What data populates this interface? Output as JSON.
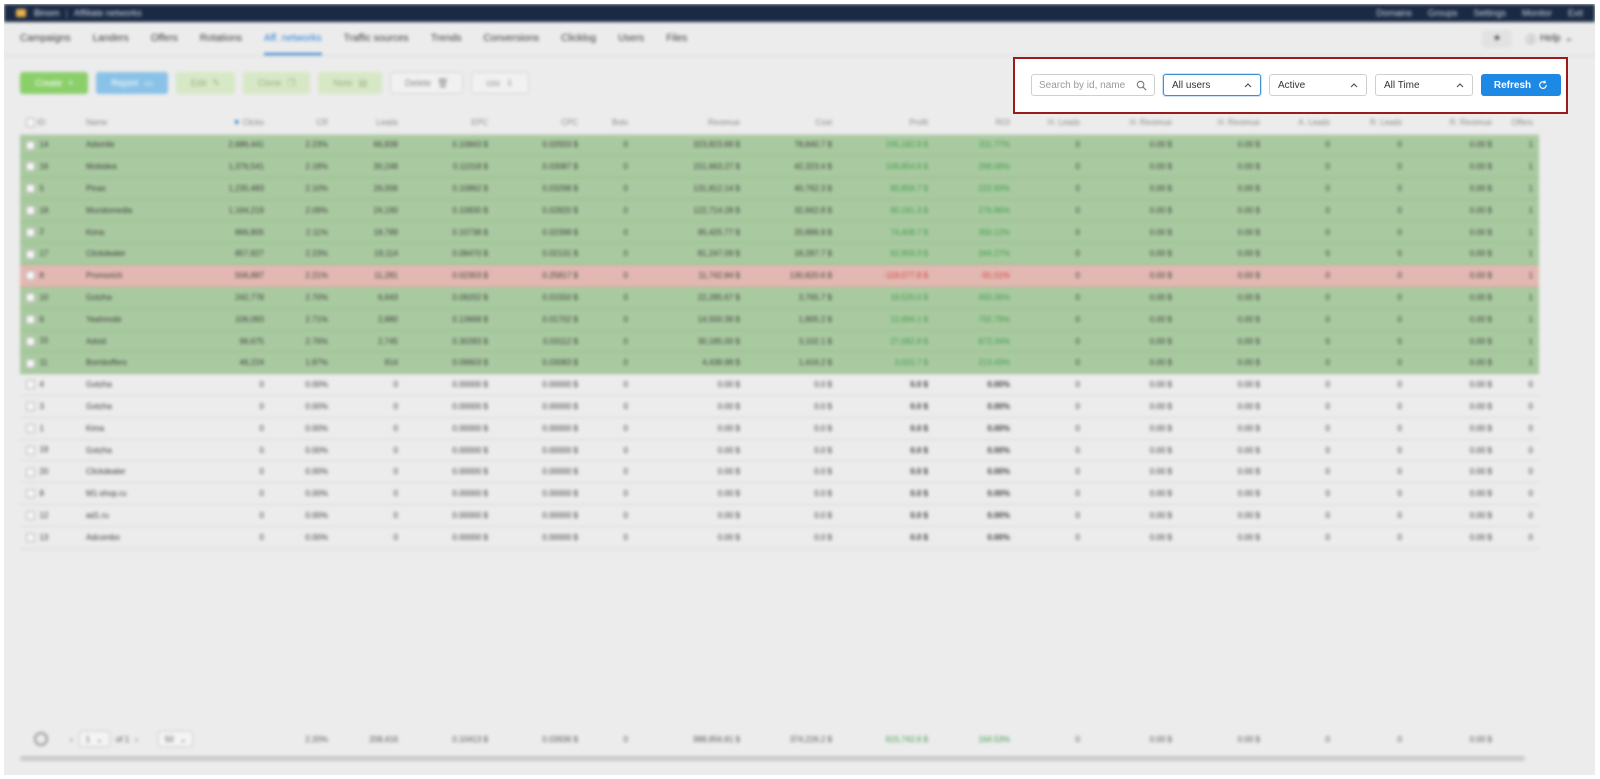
{
  "app": {
    "brand": "Binom",
    "section": "Affiliate networks",
    "top_links": [
      "Domains",
      "Groups",
      "Settings",
      "Monitor",
      "Exit"
    ]
  },
  "nav": {
    "tabs": [
      "Campaigns",
      "Landers",
      "Offers",
      "Rotations",
      "Aff. networks",
      "Traffic sources",
      "Trends",
      "Conversions",
      "Clicklog",
      "Users",
      "Files"
    ],
    "active_tab": "Aff. networks",
    "help_label": "Help"
  },
  "toolbar": {
    "create": "Create",
    "report": "Report",
    "edit": "Edit",
    "clone": "Clone",
    "note": "Note",
    "delete": "Delete",
    "csv": "csv"
  },
  "filters": {
    "search_placeholder": "Search by id, name",
    "users": "All users",
    "status": "Active",
    "period": "All Time",
    "refresh": "Refresh"
  },
  "table": {
    "columns": [
      "ID",
      "Name",
      "Clicks",
      "CR",
      "Leads",
      "EPC",
      "CPC",
      "Bots",
      "Revenue",
      "Cost",
      "Profit",
      "ROI",
      "H. Leads",
      "H. Revenue",
      "H. Revenue",
      "A. Leads",
      "R. Leads",
      "R. Revenue",
      "Offers"
    ],
    "rows": [
      {
        "status": "green",
        "id": "14",
        "name": "Adsmile",
        "clicks": "2,686,441",
        "cr": "2.23%",
        "leads": "66,839",
        "epc": "0.10843 $",
        "cpc": "0.02933 $",
        "bots": "0",
        "revenue": "323,823.89 $",
        "cost": "78,840.7 $",
        "profit": "245,182.9 $",
        "roi": "311.77%",
        "h1": "0",
        "h2": "0.00 $",
        "h3": "0.00 $",
        "h4": "0",
        "h5": "0",
        "h6": "0.00 $",
        "offers": "1"
      },
      {
        "status": "green",
        "id": "16",
        "name": "Mobidea",
        "clicks": "1,376,541",
        "cr": "2.18%",
        "leads": "30,248",
        "epc": "0.11018 $",
        "cpc": "0.03087 $",
        "bots": "0",
        "revenue": "151,663.27 $",
        "cost": "42,323.4 $",
        "profit": "109,854.9 $",
        "roi": "268.08%",
        "h1": "0",
        "h2": "0.00 $",
        "h3": "0.00 $",
        "h4": "0",
        "h5": "0",
        "h6": "0.00 $",
        "offers": "1"
      },
      {
        "status": "green",
        "id": "5",
        "name": "Pinax",
        "clicks": "1,235,483",
        "cr": "2.10%",
        "leads": "26,006",
        "epc": "0.10862 $",
        "cpc": "0.03298 $",
        "bots": "0",
        "revenue": "131,812.14 $",
        "cost": "40,762.3 $",
        "profit": "90,858.7 $",
        "roi": "222.93%",
        "h1": "0",
        "h2": "0.00 $",
        "h3": "0.00 $",
        "h4": "0",
        "h5": "0",
        "h6": "0.00 $",
        "offers": "1"
      },
      {
        "status": "green",
        "id": "18",
        "name": "Mundomedia",
        "clicks": "1,164,219",
        "cr": "2.09%",
        "leads": "24,190",
        "epc": "0.10830 $",
        "cpc": "0.02820 $",
        "bots": "0",
        "revenue": "122,714.28 $",
        "cost": "32,662.8 $",
        "profit": "90,181.3 $",
        "roi": "276.96%",
        "h1": "0",
        "h2": "0.00 $",
        "h3": "0.00 $",
        "h4": "0",
        "h5": "0",
        "h6": "0.00 $",
        "offers": "1"
      },
      {
        "status": "green",
        "id": "2",
        "name": "Kima",
        "clicks": "866,805",
        "cr": "2.11%",
        "leads": "18,789",
        "epc": "0.10738 $",
        "cpc": "0.02398 $",
        "bots": "0",
        "revenue": "95,425.77 $",
        "cost": "20,886.9 $",
        "profit": "74,408.7 $",
        "roi": "350.12%",
        "h1": "0",
        "h2": "0.00 $",
        "h3": "0.00 $",
        "h4": "0",
        "h5": "0",
        "h6": "0.00 $",
        "offers": "1"
      },
      {
        "status": "green",
        "id": "17",
        "name": "Clickdealer",
        "clicks": "857,827",
        "cr": "2.23%",
        "leads": "19,114",
        "epc": "0.08470 $",
        "cpc": "0.02131 $",
        "bots": "0",
        "revenue": "81,247.09 $",
        "cost": "18,287.7 $",
        "profit": "62,959.3 $",
        "roi": "344.27%",
        "h1": "0",
        "h2": "0.00 $",
        "h3": "0.00 $",
        "h4": "0",
        "h5": "0",
        "h6": "0.00 $",
        "offers": "1"
      },
      {
        "status": "red",
        "id": "8",
        "name": "Promorich",
        "clicks": "506,887",
        "cr": "2.21%",
        "leads": "11,281",
        "epc": "0.02303 $",
        "cpc": "0.25817 $",
        "bots": "0",
        "revenue": "11,742.84 $",
        "cost": "130,820.6 $",
        "profit": "-119,077.8 $",
        "roi": "-91.01%",
        "h1": "0",
        "h2": "0.00 $",
        "h3": "0.00 $",
        "h4": "0",
        "h5": "0",
        "h6": "0.00 $",
        "offers": "1"
      },
      {
        "status": "green",
        "id": "10",
        "name": "Gotzha",
        "clicks": "242,778",
        "cr": "2.70%",
        "leads": "6,643",
        "epc": "0.09202 $",
        "cpc": "0.01550 $",
        "bots": "0",
        "revenue": "22,285.67 $",
        "cost": "3,765.7 $",
        "profit": "18,520.0 $",
        "roi": "493.36%",
        "h1": "0",
        "h2": "0.00 $",
        "h3": "0.00 $",
        "h4": "0",
        "h5": "0",
        "h6": "0.00 $",
        "offers": "1"
      },
      {
        "status": "green",
        "id": "6",
        "name": "Yeahmobi",
        "clicks": "106,083",
        "cr": "2.71%",
        "leads": "2,880",
        "epc": "0.13668 $",
        "cpc": "0.01702 $",
        "bots": "0",
        "revenue": "14,500.39 $",
        "cost": "1,805.2 $",
        "profit": "12,694.1 $",
        "roi": "702.79%",
        "h1": "0",
        "h2": "0.00 $",
        "h3": "0.00 $",
        "h4": "0",
        "h5": "0",
        "h6": "0.00 $",
        "offers": "1"
      },
      {
        "status": "green",
        "id": "15",
        "name": "Advid",
        "clicks": "96,675",
        "cr": "2.76%",
        "leads": "2,745",
        "epc": "0.30283 $",
        "cpc": "0.03112 $",
        "bots": "0",
        "revenue": "30,185.00 $",
        "cost": "3,102.1 $",
        "profit": "27,082.8 $",
        "roi": "873.34%",
        "h1": "0",
        "h2": "0.00 $",
        "h3": "0.00 $",
        "h4": "0",
        "h5": "0",
        "h6": "0.00 $",
        "offers": "1"
      },
      {
        "status": "green",
        "id": "11",
        "name": "Bomboffers",
        "clicks": "46,224",
        "cr": "1.87%",
        "leads": "814",
        "epc": "0.09603 $",
        "cpc": "0.03083 $",
        "bots": "0",
        "revenue": "4,438.98 $",
        "cost": "1,416.2 $",
        "profit": "3,022.7 $",
        "roi": "213.43%",
        "h1": "0",
        "h2": "0.00 $",
        "h3": "0.00 $",
        "h4": "0",
        "h5": "0",
        "h6": "0.00 $",
        "offers": "1"
      },
      {
        "status": "plain",
        "id": "4",
        "name": "Gotzha",
        "clicks": "0",
        "cr": "0.00%",
        "leads": "0",
        "epc": "0.00000 $",
        "cpc": "0.00000 $",
        "bots": "0",
        "revenue": "0.00 $",
        "cost": "0.0 $",
        "profit": "0.0 $",
        "roi": "0.00%",
        "h1": "0",
        "h2": "0.00 $",
        "h3": "0.00 $",
        "h4": "0",
        "h5": "0",
        "h6": "0.00 $",
        "offers": "0"
      },
      {
        "status": "plain",
        "id": "3",
        "name": "Gotzha",
        "clicks": "0",
        "cr": "0.00%",
        "leads": "0",
        "epc": "0.00000 $",
        "cpc": "0.00000 $",
        "bots": "0",
        "revenue": "0.00 $",
        "cost": "0.0 $",
        "profit": "0.0 $",
        "roi": "0.00%",
        "h1": "0",
        "h2": "0.00 $",
        "h3": "0.00 $",
        "h4": "0",
        "h5": "0",
        "h6": "0.00 $",
        "offers": "0"
      },
      {
        "status": "plain",
        "id": "1",
        "name": "Kima",
        "clicks": "0",
        "cr": "0.00%",
        "leads": "0",
        "epc": "0.00000 $",
        "cpc": "0.00000 $",
        "bots": "0",
        "revenue": "0.00 $",
        "cost": "0.0 $",
        "profit": "0.0 $",
        "roi": "0.00%",
        "h1": "0",
        "h2": "0.00 $",
        "h3": "0.00 $",
        "h4": "0",
        "h5": "0",
        "h6": "0.00 $",
        "offers": "0"
      },
      {
        "status": "plain",
        "id": "19",
        "name": "Gotzha",
        "clicks": "0",
        "cr": "0.00%",
        "leads": "0",
        "epc": "0.00000 $",
        "cpc": "0.00000 $",
        "bots": "0",
        "revenue": "0.00 $",
        "cost": "0.0 $",
        "profit": "0.0 $",
        "roi": "0.00%",
        "h1": "0",
        "h2": "0.00 $",
        "h3": "0.00 $",
        "h4": "0",
        "h5": "0",
        "h6": "0.00 $",
        "offers": "0"
      },
      {
        "status": "plain",
        "id": "20",
        "name": "Clickdealer",
        "clicks": "0",
        "cr": "0.00%",
        "leads": "0",
        "epc": "0.00000 $",
        "cpc": "0.00000 $",
        "bots": "0",
        "revenue": "0.00 $",
        "cost": "0.0 $",
        "profit": "0.0 $",
        "roi": "0.00%",
        "h1": "0",
        "h2": "0.00 $",
        "h3": "0.00 $",
        "h4": "0",
        "h5": "0",
        "h6": "0.00 $",
        "offers": "0"
      },
      {
        "status": "plain",
        "id": "8",
        "name": "M1-shop.ru",
        "clicks": "0",
        "cr": "0.00%",
        "leads": "0",
        "epc": "0.00000 $",
        "cpc": "0.00000 $",
        "bots": "0",
        "revenue": "0.00 $",
        "cost": "0.0 $",
        "profit": "0.0 $",
        "roi": "0.00%",
        "h1": "0",
        "h2": "0.00 $",
        "h3": "0.00 $",
        "h4": "0",
        "h5": "0",
        "h6": "0.00 $",
        "offers": "0"
      },
      {
        "status": "plain",
        "id": "12",
        "name": "ad1.ru",
        "clicks": "0",
        "cr": "0.00%",
        "leads": "0",
        "epc": "0.00000 $",
        "cpc": "0.00000 $",
        "bots": "0",
        "revenue": "0.00 $",
        "cost": "0.0 $",
        "profit": "0.0 $",
        "roi": "0.00%",
        "h1": "0",
        "h2": "0.00 $",
        "h3": "0.00 $",
        "h4": "0",
        "h5": "0",
        "h6": "0.00 $",
        "offers": "0"
      },
      {
        "status": "plain",
        "id": "13",
        "name": "Adcombo",
        "clicks": "0",
        "cr": "0.00%",
        "leads": "0",
        "epc": "0.00000 $",
        "cpc": "0.00000 $",
        "bots": "0",
        "revenue": "0.00 $",
        "cost": "0.0 $",
        "profit": "0.0 $",
        "roi": "0.00%",
        "h1": "0",
        "h2": "0.00 $",
        "h3": "0.00 $",
        "h4": "0",
        "h5": "0",
        "h6": "0.00 $",
        "offers": "0"
      }
    ]
  },
  "footer": {
    "page": "1",
    "of_label": "of 1",
    "per_page": "50",
    "totals": {
      "cr": "2.20%",
      "leads": "208,416",
      "epc": "0.10413 $",
      "cpc": "0.03936 $",
      "bots": "0",
      "revenue": "988,856.81 $",
      "cost": "374,226.2 $",
      "profit": "615,742.6 $",
      "roi": "164.53%",
      "h1": "0",
      "h2": "0.00 $",
      "h3": "0.00 $",
      "h4": "0",
      "h5": "0",
      "h6": "0.00 $"
    }
  },
  "colors": {
    "accent": "#1e88e5",
    "highlight_border": "#9b1b1b",
    "profit_positive": "#3d9a4c",
    "profit_negative": "#d23d3d",
    "row_positive": "#a9caa0",
    "row_negative": "#e3b8b2"
  }
}
